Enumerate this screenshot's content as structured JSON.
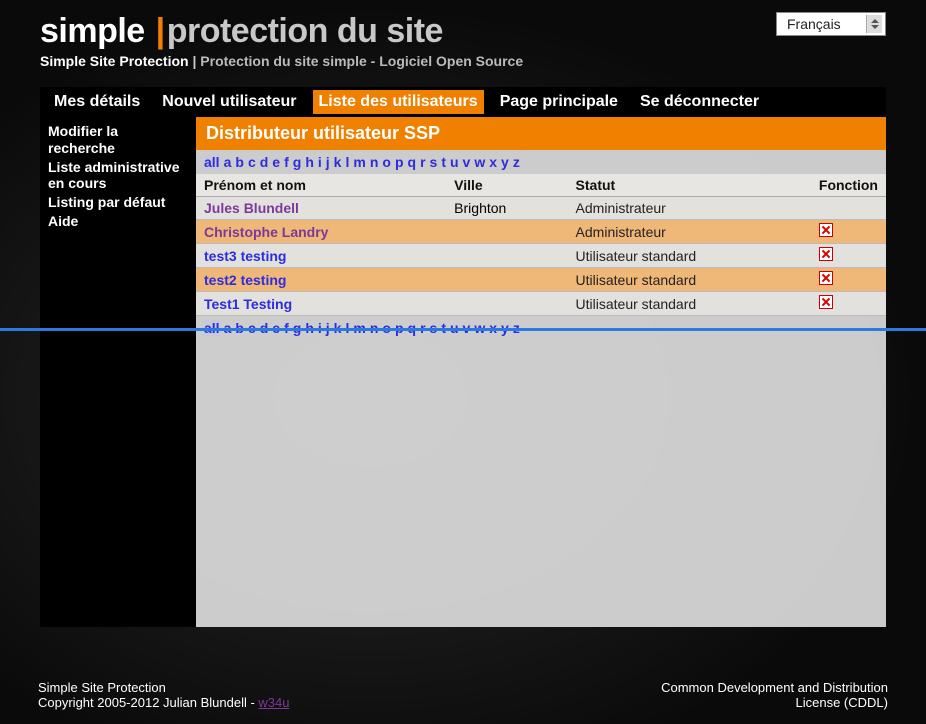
{
  "header": {
    "title_part1": "simple",
    "title_bar": "|",
    "title_part2": "protection du site",
    "subtitle_left": "Simple Site Protection",
    "subtitle_bar": "|",
    "subtitle_right": "Protection du site simple - Logiciel Open Source"
  },
  "language": {
    "selected": "Français"
  },
  "nav": {
    "items": [
      {
        "label": "Mes détails",
        "active": false
      },
      {
        "label": "Nouvel utilisateur",
        "active": false
      },
      {
        "label": "Liste des utilisateurs",
        "active": true
      },
      {
        "label": "Page principale",
        "active": false
      },
      {
        "label": "Se déconnecter",
        "active": false
      }
    ]
  },
  "sidebar": {
    "items": [
      {
        "label": "Modifier la recherche"
      },
      {
        "label": "Liste administrative en cours"
      },
      {
        "label": "Listing par défaut"
      },
      {
        "label": "Aide"
      }
    ]
  },
  "main": {
    "heading": "Distributeur utilisateur SSP",
    "alpha": [
      "all",
      "a",
      "b",
      "c",
      "d",
      "e",
      "f",
      "g",
      "h",
      "i",
      "j",
      "k",
      "l",
      "m",
      "n",
      "o",
      "p",
      "q",
      "r",
      "s",
      "t",
      "u",
      "v",
      "w",
      "x",
      "y",
      "z"
    ],
    "columns": {
      "name": "Prénom et nom",
      "city": "Ville",
      "status": "Statut",
      "function": "Fonction"
    },
    "rows": [
      {
        "name": "Jules Blundell",
        "city": "Brighton",
        "status": "Administrateur",
        "delete": false,
        "visited": true
      },
      {
        "name": "Christophe Landry",
        "city": "",
        "status": "Administrateur",
        "delete": true,
        "visited": true
      },
      {
        "name": "test3 testing",
        "city": "",
        "status": "Utilisateur standard",
        "delete": true,
        "visited": false
      },
      {
        "name": "test2 testing",
        "city": "",
        "status": "Utilisateur standard",
        "delete": true,
        "visited": false
      },
      {
        "name": "Test1 Testing",
        "city": "",
        "status": "Utilisateur standard",
        "delete": true,
        "visited": false
      }
    ]
  },
  "footer": {
    "left_line1": "Simple Site Protection",
    "left_line2": "Copyright 2005-2012 Julian Blundell - ",
    "left_link": "w34u",
    "right_line1": "Common Development and Distribution",
    "right_line2": "License (CDDL)"
  }
}
